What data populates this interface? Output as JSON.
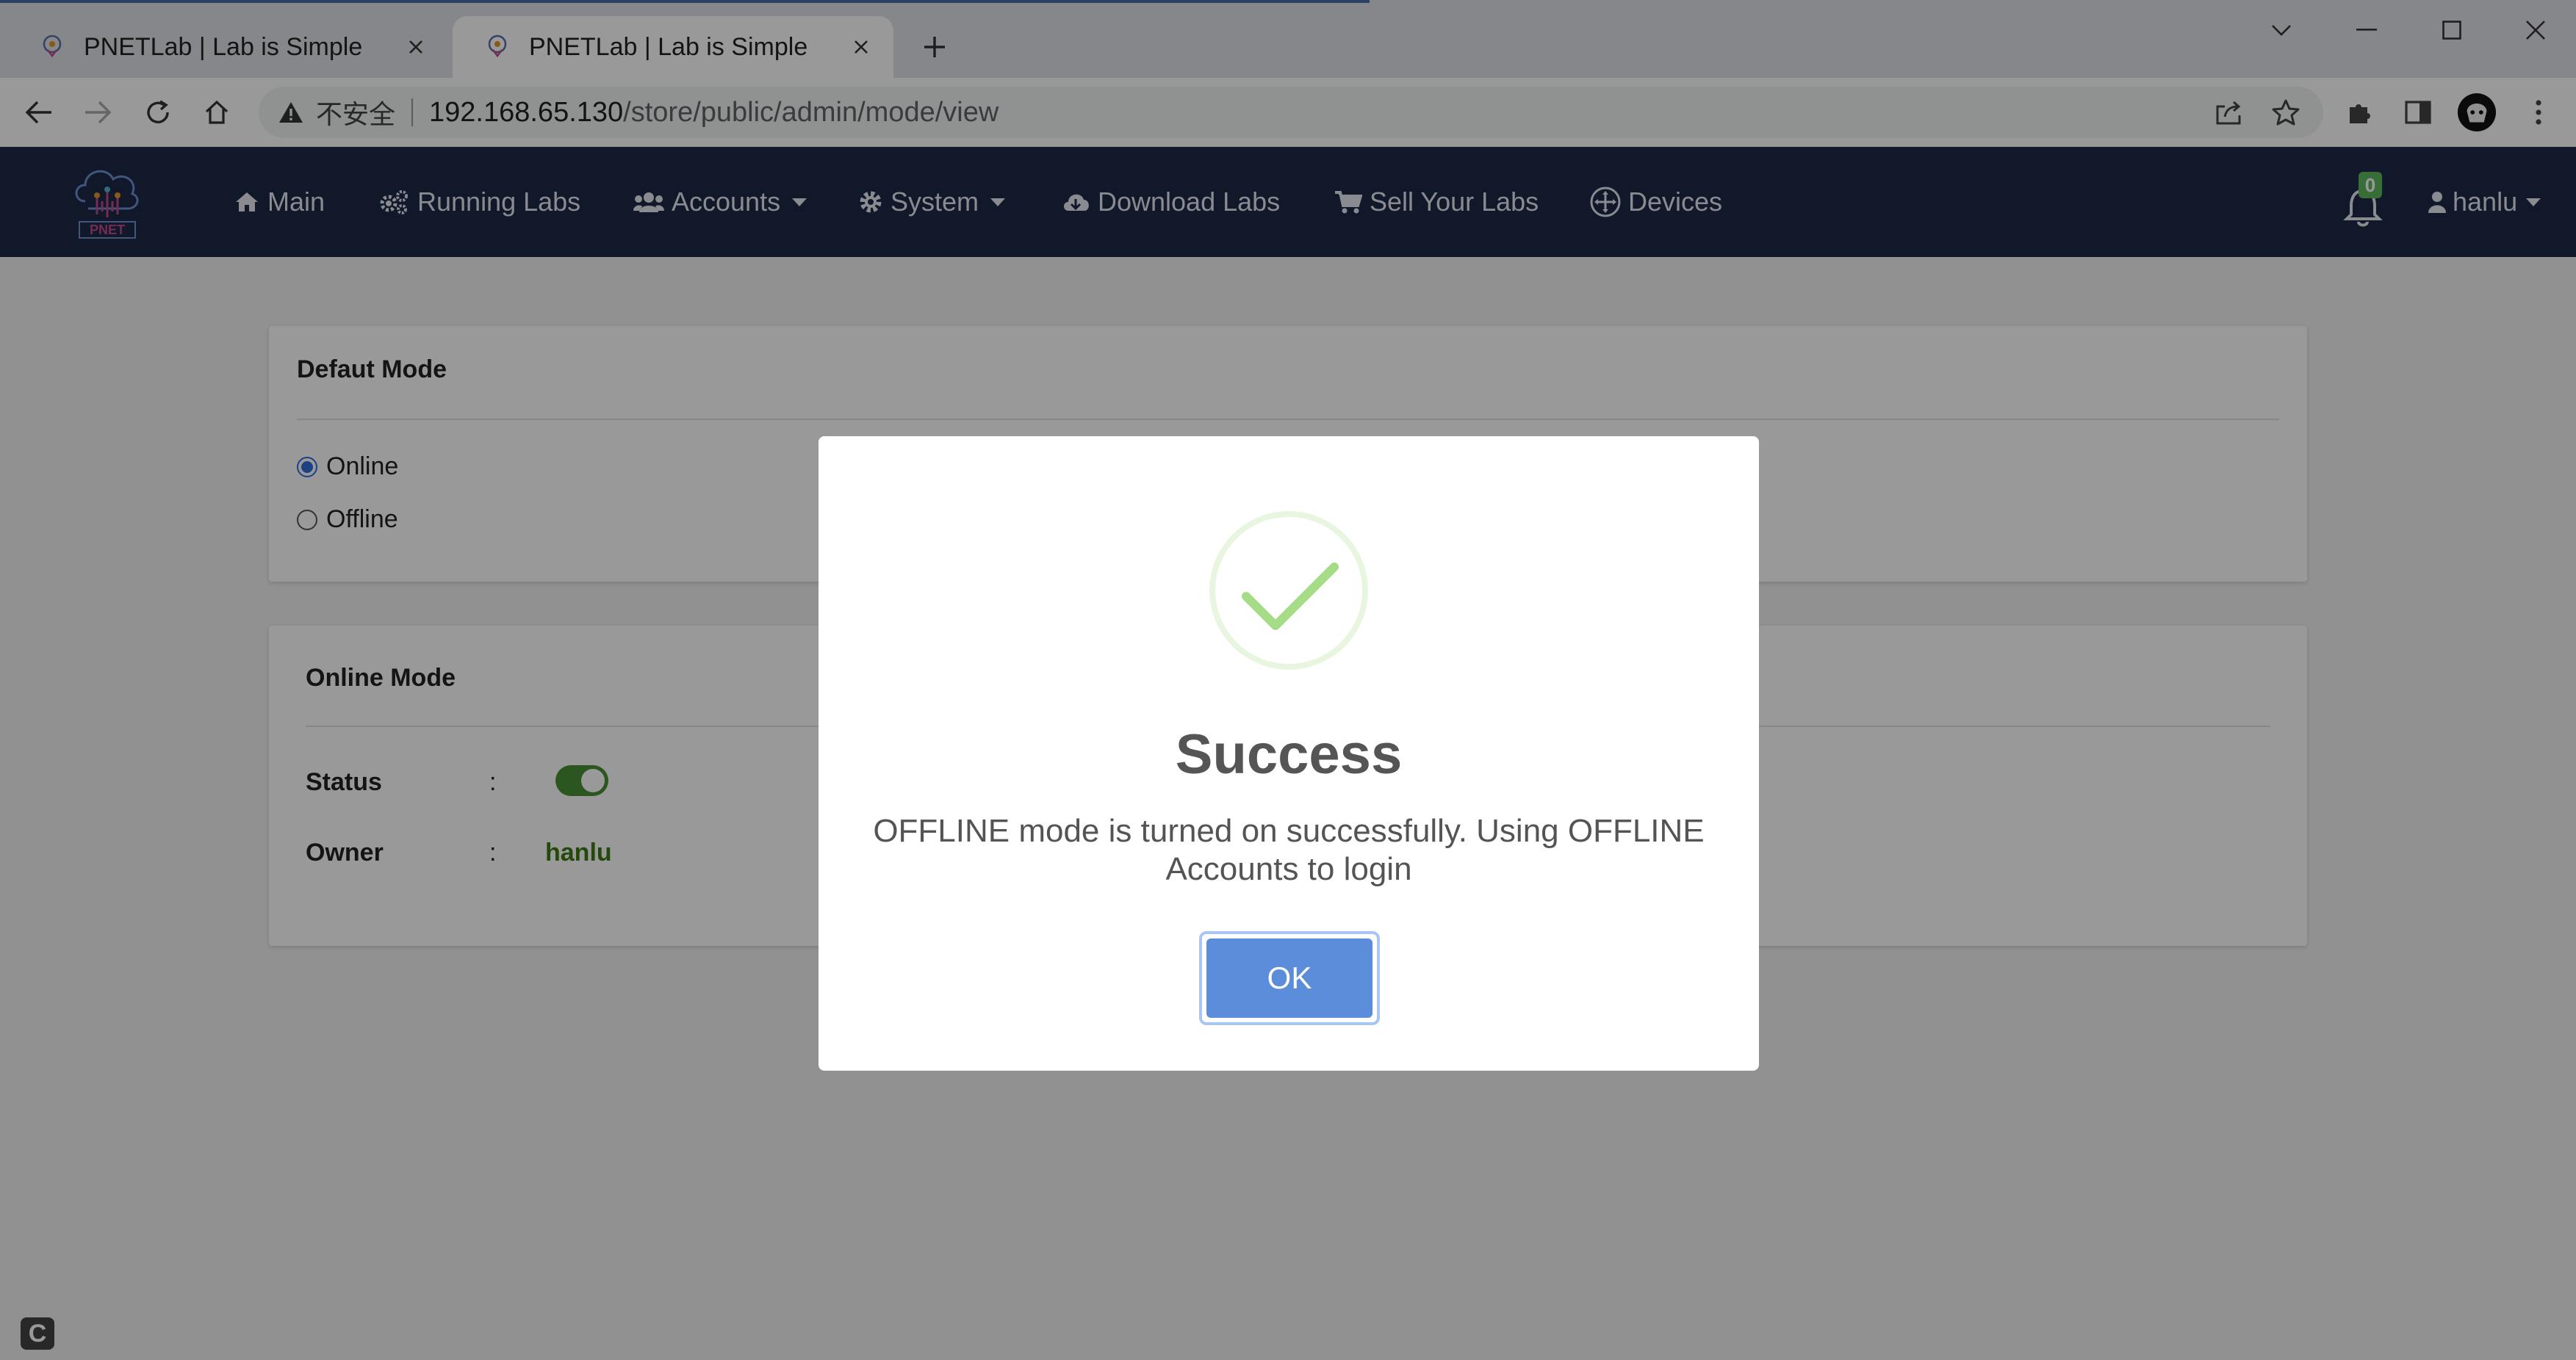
{
  "browser": {
    "tabs": [
      {
        "title": "PNETLab | Lab is Simple",
        "active": false
      },
      {
        "title": "PNETLab | Lab is Simple",
        "active": true
      }
    ],
    "security_label": "不安全",
    "url_host": "192.168.65.130",
    "url_path": "/store/public/admin/mode/view"
  },
  "navbar": {
    "logo_text": "PNET",
    "items": [
      {
        "label": "Main",
        "icon": "home-icon"
      },
      {
        "label": "Running Labs",
        "icon": "cogs-icon"
      },
      {
        "label": "Accounts",
        "icon": "users-icon",
        "dropdown": true
      },
      {
        "label": "System",
        "icon": "gear-icon",
        "dropdown": true
      },
      {
        "label": "Download Labs",
        "icon": "cloud-download-icon"
      },
      {
        "label": "Sell Your Labs",
        "icon": "cart-icon"
      },
      {
        "label": "Devices",
        "icon": "arrows-move-icon"
      }
    ],
    "notification_count": "0",
    "user": "hanlu"
  },
  "default_mode": {
    "title": "Defaut Mode",
    "options": [
      {
        "label": "Online",
        "checked": true
      },
      {
        "label": "Offline",
        "checked": false
      }
    ]
  },
  "online_mode": {
    "title": "Online Mode",
    "status_label": "Status",
    "status_on": true,
    "owner_label": "Owner",
    "owner_value": "hanlu",
    "separator": ":"
  },
  "corner_badge": "C",
  "modal": {
    "title": "Success",
    "message_line1": "OFFLINE mode is turned on successfully. Using OFFLINE",
    "message_line2": "Accounts to login",
    "ok_label": "OK",
    "icon": "success-check-icon"
  },
  "colors": {
    "navbar_bg": "#1b2845",
    "ok_button": "#5b8dda",
    "check_green": "#a5dc86",
    "toggle_on": "#4a8f34",
    "owner_text": "#3d7a12",
    "badge_green": "#5cb85c"
  }
}
